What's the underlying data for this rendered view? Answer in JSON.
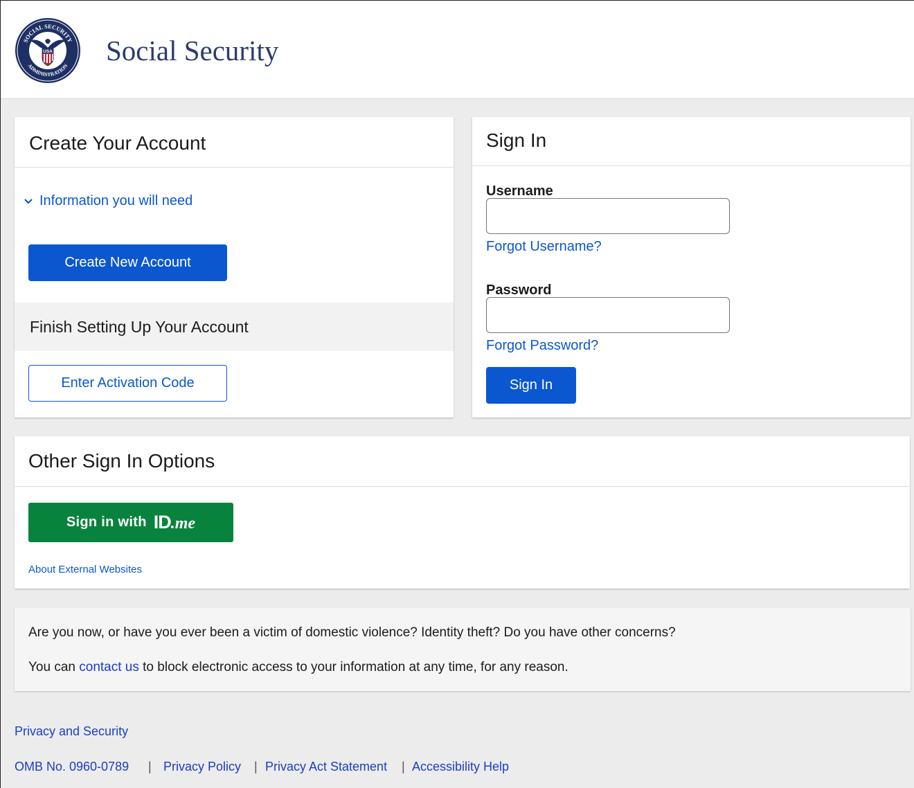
{
  "header": {
    "brand": "Social Security"
  },
  "create_account": {
    "title": "Create Your Account",
    "info_toggle": "Information you will need",
    "create_button": "Create New Account",
    "finish_title": "Finish Setting Up Your Account",
    "activation_button": "Enter Activation Code"
  },
  "sign_in": {
    "title": "Sign In",
    "username_label": "Username",
    "username_value": "",
    "forgot_username": "Forgot Username?",
    "password_label": "Password",
    "password_value": "",
    "forgot_password": "Forgot Password?",
    "submit_button": "Sign In"
  },
  "other_options": {
    "title": "Other Sign In Options",
    "idme_prefix": "Sign in with",
    "idme_logo_id": "ID",
    "idme_logo_me": ".me",
    "about_external": "About External Websites"
  },
  "notice": {
    "line1": "Are you now, or have you ever been a victim of domestic violence? Identity theft? Do you have other concerns?",
    "line2_pre": "You can ",
    "line2_link": "contact us",
    "line2_post": " to block electronic access to your information at any time, for any reason."
  },
  "footer": {
    "privacy_security": "Privacy and Security",
    "omb": "OMB No. 0960-0789",
    "privacy_policy": "Privacy Policy",
    "privacy_act": "Privacy Act Statement",
    "accessibility": "Accessibility Help",
    "separator": "|"
  },
  "colors": {
    "primary_blue": "#0b57d0",
    "idme_green": "#08833d",
    "brand_navy": "#2b3d6b"
  },
  "icons": {
    "seal": "ssa-seal-logo",
    "toggle": "chevron-down-icon"
  },
  "seal_text": {
    "top": "SOCIAL SECURITY",
    "bottom": "ADMINISTRATION",
    "shield": "USA"
  }
}
